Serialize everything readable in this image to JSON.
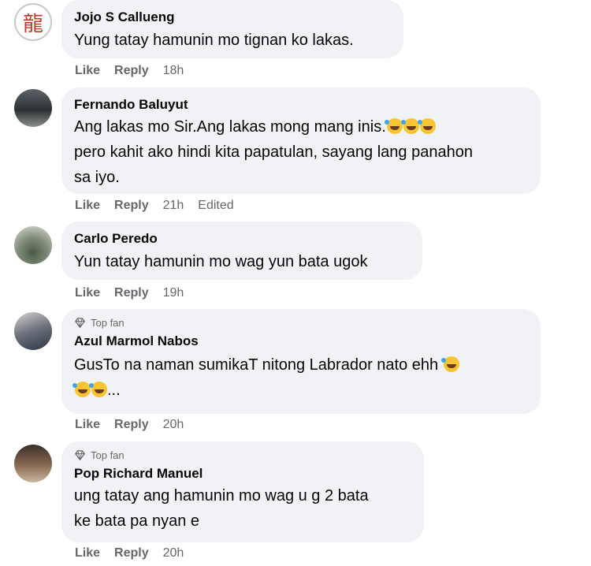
{
  "comments": [
    {
      "name": "Jojo S Callueng",
      "top_fan": "",
      "lines": [
        "Yung tatay hamunin mo tignan ko lakas."
      ],
      "like": "Like",
      "reply": "Reply",
      "time": "18h",
      "edited": "",
      "avatar_glyph": "龍",
      "avatar_icon": "dragon-character-avatar"
    },
    {
      "name": "Fernando Baluyut",
      "top_fan": "",
      "lines": [
        "Ang lakas mo Sir.Ang lakas mong mang inis.",
        "pero kahit ako hindi kita papatulan, sayang lang panahon",
        "sa iyo."
      ],
      "like": "Like",
      "reply": "Reply",
      "time": "21h",
      "edited": "Edited",
      "avatar_icon": "photo-avatar"
    },
    {
      "name": "Carlo Peredo",
      "top_fan": "",
      "lines": [
        "Yun tatay hamunin mo wag yun bata ugok"
      ],
      "like": "Like",
      "reply": "Reply",
      "time": "19h",
      "edited": "",
      "avatar_icon": "photo-avatar"
    },
    {
      "name": "Azul Marmol Nabos",
      "top_fan": "Top fan",
      "lines": [
        "GusTo na naman sumikaT nitong Labrador nato ehh",
        "..."
      ],
      "like": "Like",
      "reply": "Reply",
      "time": "20h",
      "edited": "",
      "avatar_icon": "photo-avatar"
    },
    {
      "name": "Pop Richard Manuel",
      "top_fan": "Top fan",
      "lines": [
        "ung tatay ang hamunin mo wag u g 2 bata",
        "ke bata pa nyan e"
      ],
      "like": "Like",
      "reply": "Reply",
      "time": "20h",
      "edited": "",
      "avatar_icon": "photo-avatar"
    }
  ],
  "colors": {
    "bubble": "#f0f2f5",
    "meta": "#65676b",
    "text": "#050505"
  }
}
